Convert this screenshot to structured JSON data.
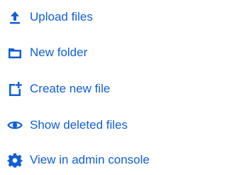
{
  "theme": {
    "accent": "#0F5FD9",
    "background": "#FFFFFF"
  },
  "menu": {
    "items": [
      {
        "label": "Upload files",
        "icon": "upload-icon"
      },
      {
        "label": "New folder",
        "icon": "folder-icon"
      },
      {
        "label": "Create new file",
        "icon": "new-file-icon"
      },
      {
        "label": "Show deleted files",
        "icon": "eye-icon"
      },
      {
        "label": "View in admin console",
        "icon": "gear-icon"
      }
    ]
  }
}
